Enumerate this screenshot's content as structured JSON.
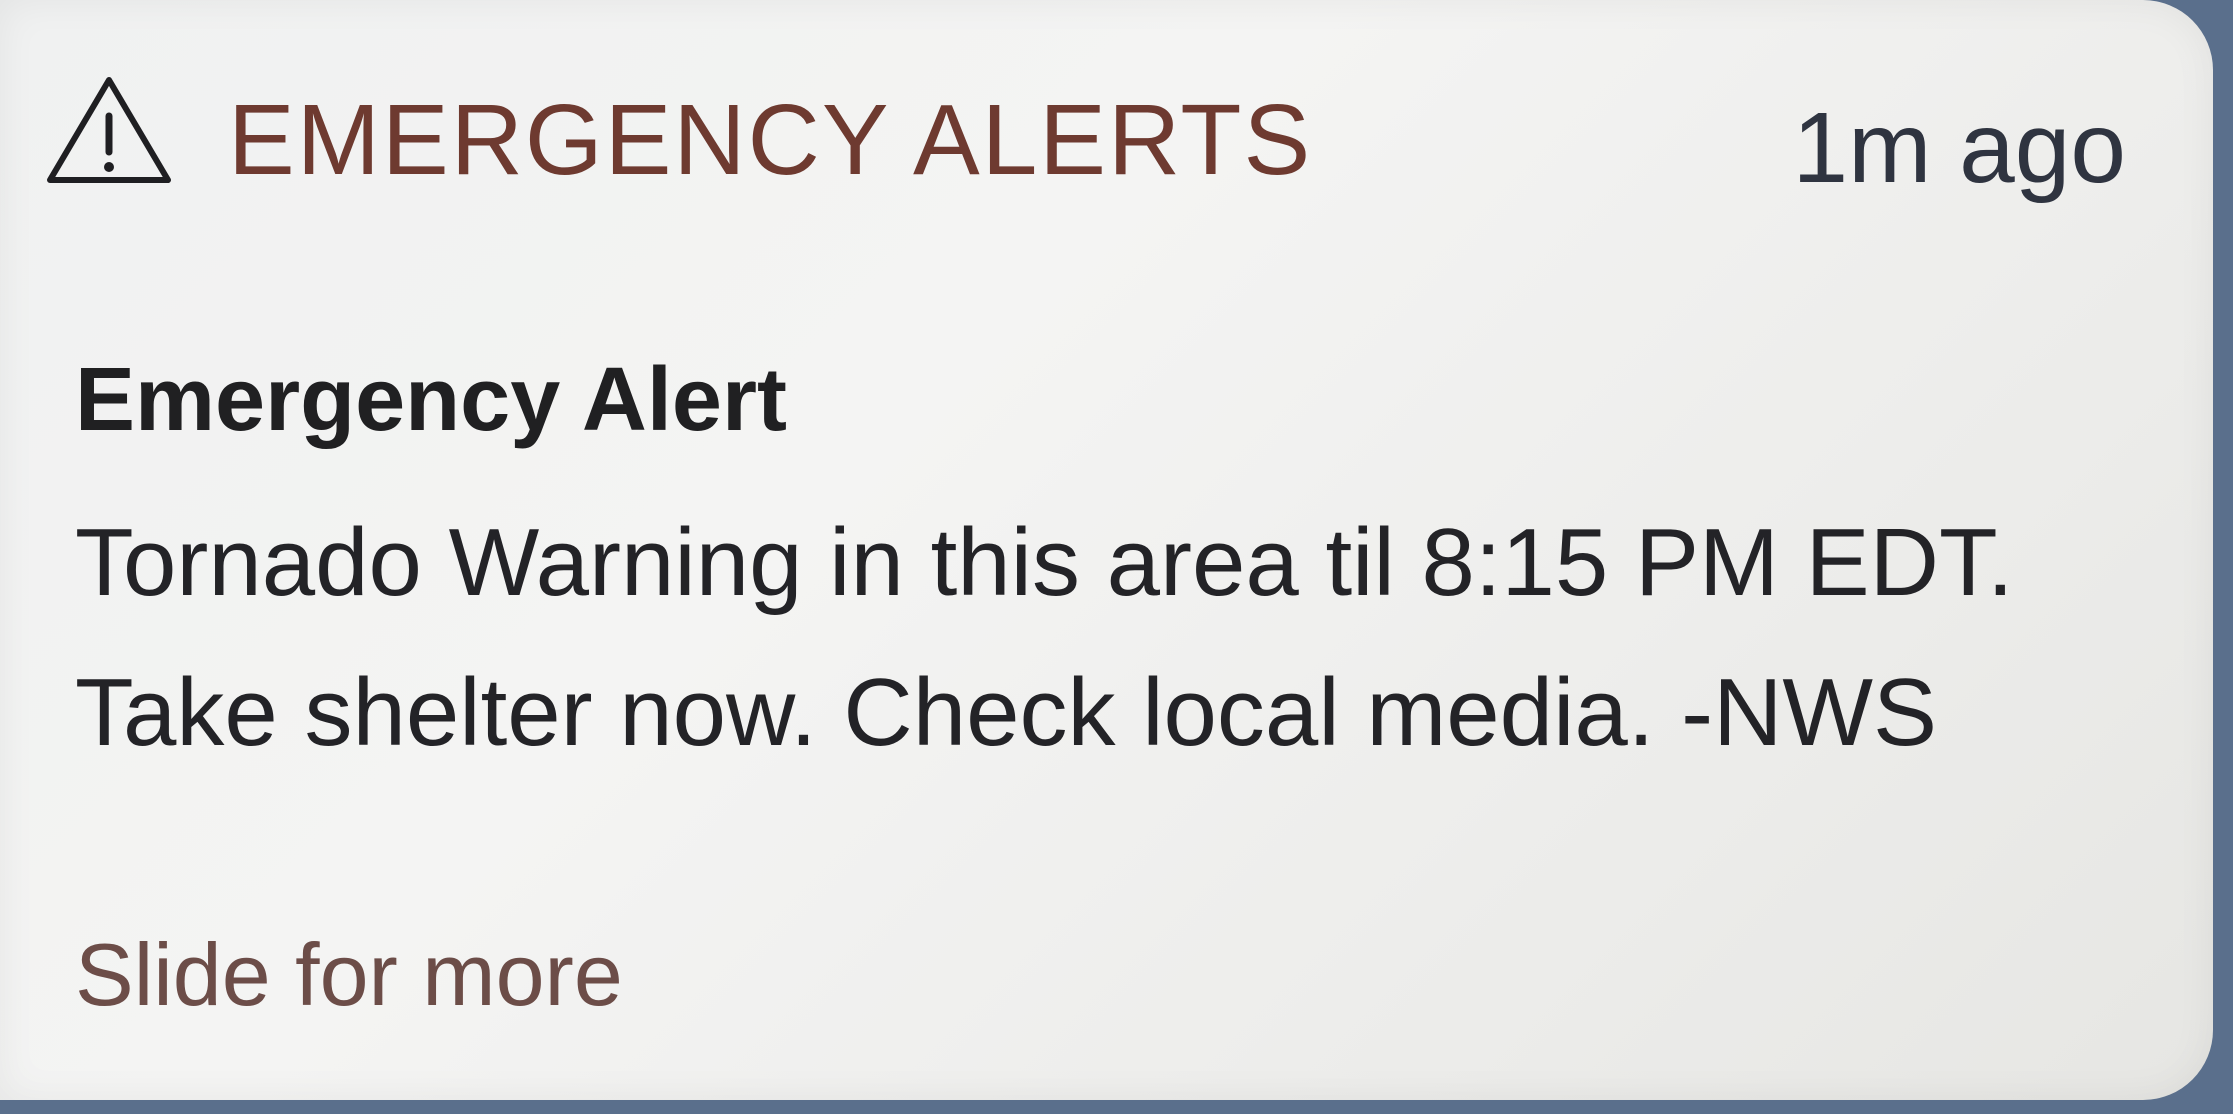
{
  "notification": {
    "app_name": "EMERGENCY ALERTS",
    "timestamp": "1m ago",
    "icon": "warning-triangle-icon",
    "title": "Emergency Alert",
    "body": "Tornado Warning in this area til 8:15 PM EDT. Take shelter now. Check local media. -NWS",
    "action_hint": "Slide for more"
  },
  "colors": {
    "app_name": "#6e3a30",
    "text": "#232327",
    "hint": "#6c4d48",
    "background": "#f1f1f0"
  }
}
